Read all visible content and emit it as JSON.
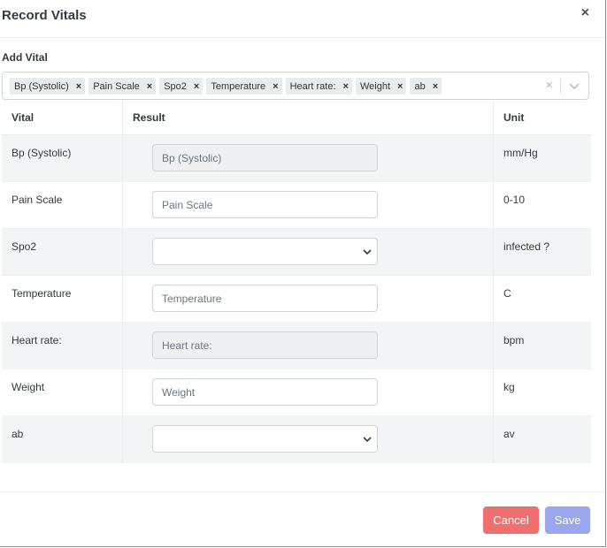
{
  "modal": {
    "title": "Record Vitals",
    "close_icon": "close-icon",
    "close_glyph": "×"
  },
  "add_vital": {
    "label": "Add Vital",
    "selected": [
      {
        "label": "Bp (Systolic)"
      },
      {
        "label": "Pain Scale"
      },
      {
        "label": "Spo2"
      },
      {
        "label": "Temperature"
      },
      {
        "label": "Heart rate:"
      },
      {
        "label": "Weight"
      },
      {
        "label": "ab"
      }
    ],
    "remove_glyph": "×",
    "clear_glyph": "×"
  },
  "table": {
    "headers": {
      "vital": "Vital",
      "result": "Result",
      "unit": "Unit"
    },
    "rows": [
      {
        "vital": "Bp (Systolic)",
        "input": "text",
        "readonly": true,
        "placeholder": "Bp (Systolic)",
        "unit": "mm/Hg"
      },
      {
        "vital": "Pain Scale",
        "input": "text",
        "readonly": false,
        "placeholder": "Pain Scale",
        "unit": "0-10"
      },
      {
        "vital": "Spo2",
        "input": "select",
        "value": "",
        "unit": "infected ?"
      },
      {
        "vital": "Temperature",
        "input": "text",
        "readonly": false,
        "placeholder": "Temperature",
        "unit": "C"
      },
      {
        "vital": "Heart rate:",
        "input": "text",
        "readonly": true,
        "placeholder": "Heart rate:",
        "unit": "bpm"
      },
      {
        "vital": "Weight",
        "input": "text",
        "readonly": false,
        "placeholder": "Weight",
        "unit": "kg"
      },
      {
        "vital": "ab",
        "input": "select",
        "value": "",
        "unit": "av"
      }
    ]
  },
  "footer": {
    "cancel_label": "Cancel",
    "save_label": "Save"
  },
  "colors": {
    "cancel": "#ef6f6f",
    "save": "#9aa6ee",
    "stripe": "#f2f4f6"
  }
}
